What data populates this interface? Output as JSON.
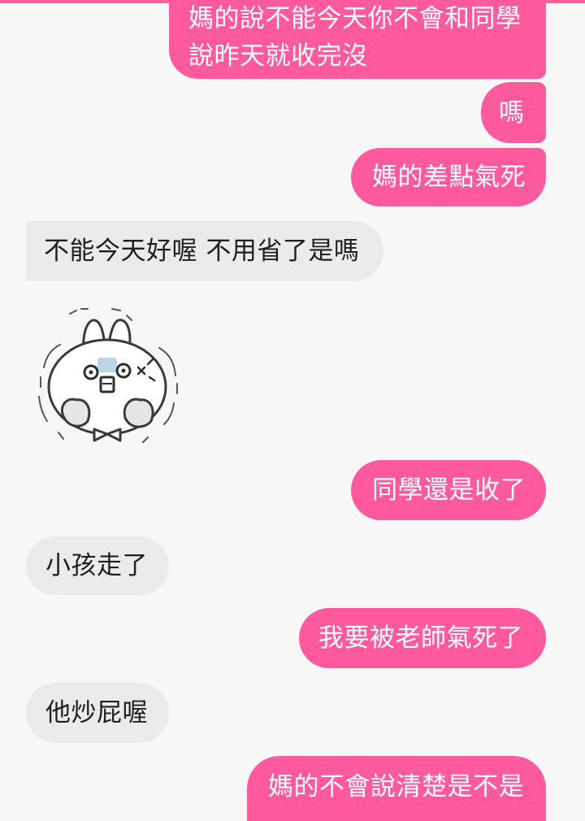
{
  "conversation": {
    "messages": [
      {
        "direction": "outgoing",
        "lines": [
          "媽的說不能今天你不會和同學",
          "說昨天就收完沒"
        ]
      },
      {
        "direction": "outgoing",
        "text": "嗎"
      },
      {
        "direction": "outgoing",
        "text": "媽的差點氣死"
      },
      {
        "direction": "incoming",
        "text": "不能今天好喔 不用省了是嗎"
      },
      {
        "direction": "incoming",
        "type": "sticker",
        "sticker": "angry-white-rabbit-sticker"
      },
      {
        "direction": "outgoing",
        "text": "同學還是收了"
      },
      {
        "direction": "incoming",
        "text": "小孩走了"
      },
      {
        "direction": "outgoing",
        "text": "我要被老師氣死了"
      },
      {
        "direction": "incoming",
        "text": "他炒屁喔"
      },
      {
        "direction": "outgoing",
        "text": "媽的不會說清楚是不是"
      }
    ]
  },
  "theme": {
    "outgoing_bubble_color": "#ff5a9e",
    "incoming_bubble_color": "#ebebeb",
    "background_color": "#f7f7f8"
  }
}
